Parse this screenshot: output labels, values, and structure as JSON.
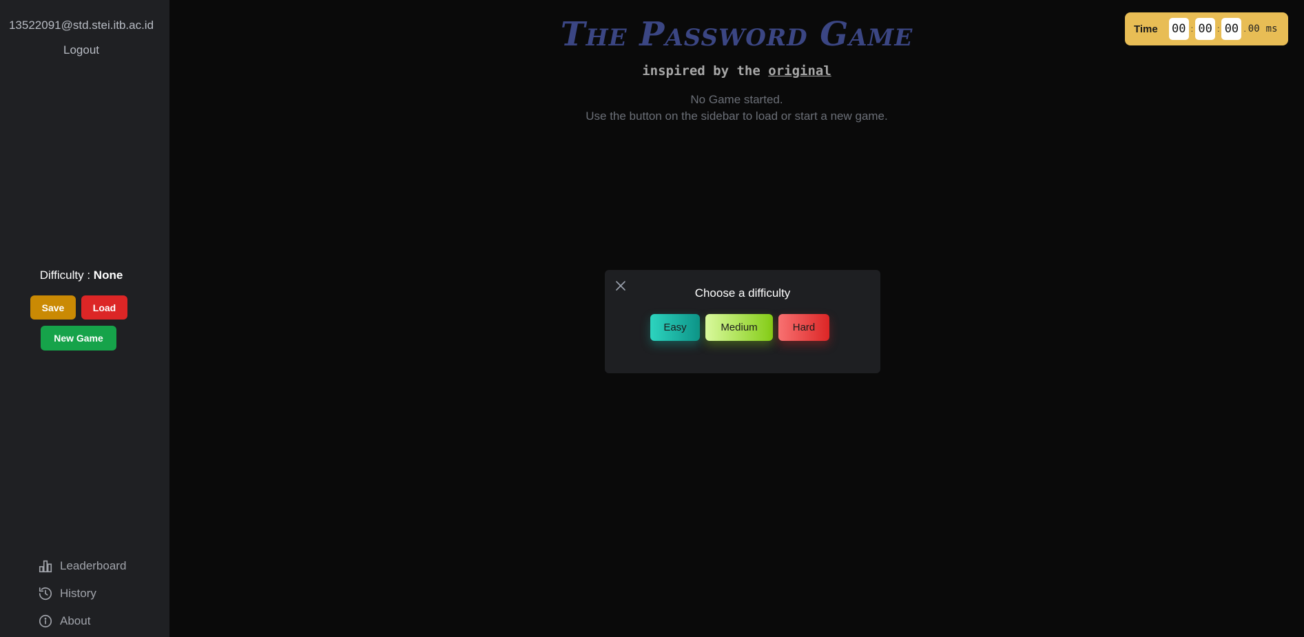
{
  "sidebar": {
    "user_email": "13522091@std.stei.itb.ac.id",
    "logout_label": "Logout",
    "difficulty_label": "Difficulty : ",
    "difficulty_value": "None",
    "save_label": "Save",
    "load_label": "Load",
    "new_game_label": "New Game",
    "nav": [
      {
        "label": "Leaderboard",
        "icon": "bar-chart-icon"
      },
      {
        "label": "History",
        "icon": "history-icon"
      },
      {
        "label": "About",
        "icon": "info-icon"
      }
    ]
  },
  "main": {
    "title": "The Password Game",
    "subtitle_prefix": "inspired by the ",
    "subtitle_link": "original",
    "status_line1": "No Game started.",
    "status_line2": "Use the button on the sidebar to load or start a new game."
  },
  "timer": {
    "label": "Time",
    "hours": "00",
    "minutes": "00",
    "seconds": "00",
    "millis": "00",
    "unit": "ms"
  },
  "modal": {
    "title": "Choose a difficulty",
    "options": [
      "Easy",
      "Medium",
      "Hard"
    ],
    "close_icon": "close-icon"
  },
  "colors": {
    "background": "#0a0a0a",
    "sidebar": "#1f2023",
    "title": "#3b4683",
    "timer_bg": "#e8bd55",
    "save": "#ca8a04",
    "load": "#dc2626",
    "new_game": "#16a34a",
    "easy": "#14b8a6",
    "medium": "#84cc16",
    "hard": "#ef4444"
  }
}
